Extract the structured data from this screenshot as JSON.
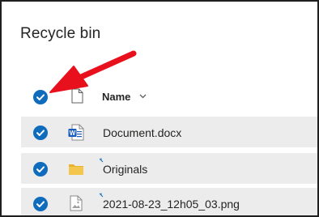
{
  "page": {
    "title": "Recycle bin"
  },
  "list": {
    "header": {
      "name_label": "Name",
      "sort_icon": "chevron-down-icon",
      "select_all_checked": true
    },
    "items": [
      {
        "name": "Document.docx",
        "icon": "word-document-icon",
        "selected": true
      },
      {
        "name": "Originals",
        "icon": "folder-icon",
        "selected": true
      },
      {
        "name": "2021-08-23_12h05_03.png",
        "icon": "image-file-icon",
        "selected": true
      }
    ]
  },
  "annotation": {
    "arrow_color": "#e8101d",
    "points_to": "select-all-checkbox"
  },
  "colors": {
    "check_blue": "#0f6cbd",
    "row_bg": "#ececec",
    "word_blue": "#185abd",
    "folder_yellow": "#f4c64b"
  }
}
